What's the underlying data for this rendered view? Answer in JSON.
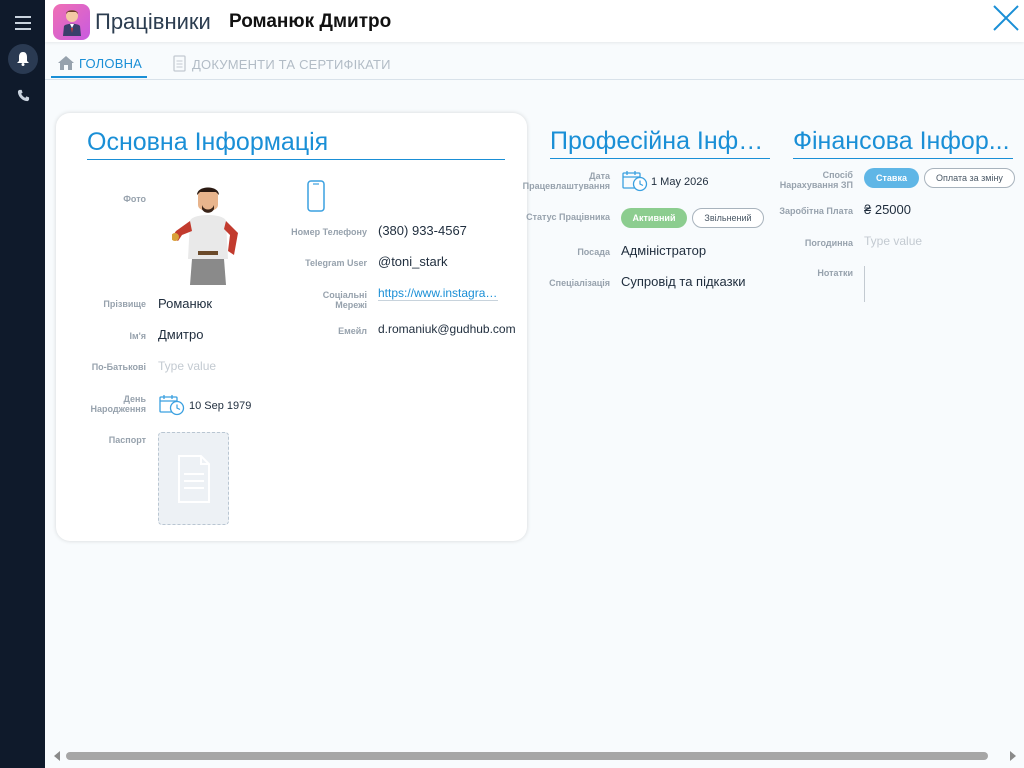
{
  "header": {
    "app_title": "Працівники",
    "record_title": "Романюк Дмитро"
  },
  "tabs": [
    {
      "label": "ГОЛОВНА"
    },
    {
      "label": "ДОКУМЕНТИ ТА СЕРТИФІКАТИ"
    }
  ],
  "main_info": {
    "title": "Основна Інформація",
    "photo_label": "Фото",
    "surname_label": "Прізвище",
    "surname": "Романюк",
    "name_label": "Ім'я",
    "name": "Дмитро",
    "patronymic_label": "По-Батькові",
    "patronymic_placeholder": "Type value",
    "birthday_label": "День Народження",
    "birthday": "10 Sep 1979",
    "passport_label": "Паспорт",
    "phone_label": "Номер Телефону",
    "phone": "(380) 933-4567",
    "telegram_label": "Telegram User",
    "telegram": "@toni_stark",
    "social_label": "Соціальні Мережі",
    "social": "https://www.instagram.com/",
    "email_label": "Емейл",
    "email": "d.romaniuk@gudhub.com"
  },
  "professional": {
    "title": "Професійна Інфо...",
    "hire_date_label": "Дата Працевлаштування",
    "hire_date": "1 May 2026",
    "status_label": "Статус Працівника",
    "status_active": "Активний",
    "status_fired": "Звільнений",
    "position_label": "Посада",
    "position": "Адміністратор",
    "specialization_label": "Спеціалізація",
    "specialization": "Супровід та підказки"
  },
  "financial": {
    "title": "Фінансова Інфор...",
    "pay_method_label": "Спосіб Нарахування ЗП",
    "pay_rate": "Ставка",
    "pay_shift": "Оплата за зміну",
    "salary_label": "Заробітна Плата",
    "salary": "₴ 25000",
    "hourly_label": "Погодинна",
    "hourly_placeholder": "Type value",
    "notes_label": "Нотатки"
  },
  "colors": {
    "accent": "#1a8fd6",
    "rail": "#0f1a2b",
    "active_green": "#8ccd8f",
    "rate_blue": "#5fb6e6"
  },
  "icons": {
    "menu": "menu-icon",
    "bell": "bell-icon",
    "phone": "phone-icon",
    "close": "close-icon",
    "home": "home-icon",
    "document": "document-icon",
    "calendar": "calendar-clock-icon",
    "mobile": "mobile-phone-icon"
  }
}
